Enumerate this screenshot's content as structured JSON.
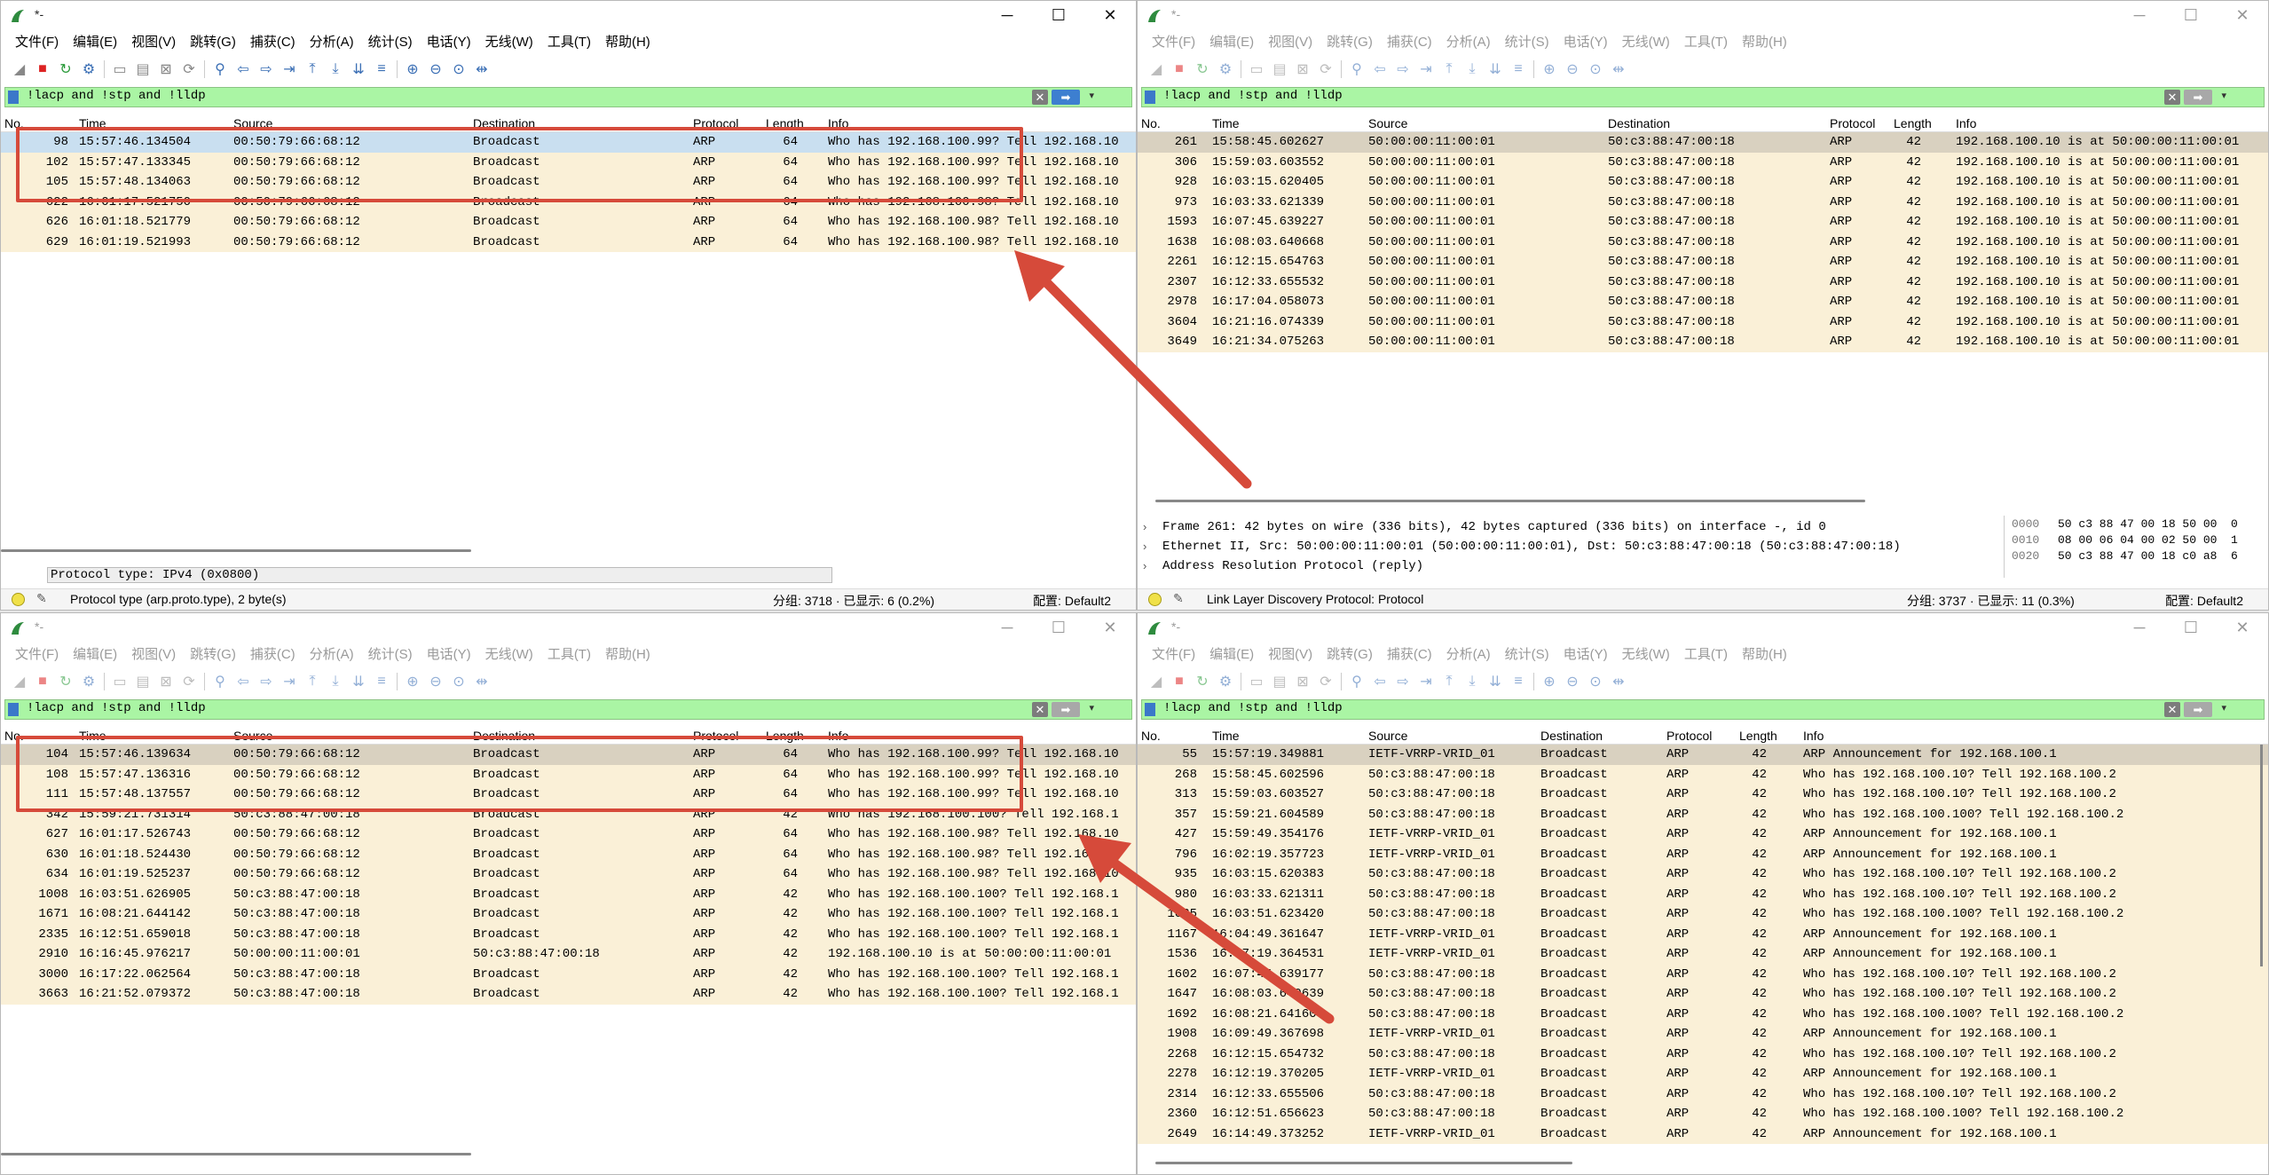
{
  "windows": {
    "tl": {
      "title": "*-",
      "filter": "!lacp and !stp and !lldp",
      "columns": [
        "No.",
        "Time",
        "Source",
        "Destination",
        "Protocol",
        "Length",
        "Info"
      ],
      "rows": [
        [
          "98",
          "15:57:46.134504",
          "00:50:79:66:68:12",
          "Broadcast",
          "ARP",
          "64",
          "Who has 192.168.100.99? Tell 192.168.10"
        ],
        [
          "102",
          "15:57:47.133345",
          "00:50:79:66:68:12",
          "Broadcast",
          "ARP",
          "64",
          "Who has 192.168.100.99? Tell 192.168.10"
        ],
        [
          "105",
          "15:57:48.134063",
          "00:50:79:66:68:12",
          "Broadcast",
          "ARP",
          "64",
          "Who has 192.168.100.99? Tell 192.168.10"
        ],
        [
          "622",
          "16:01:17.521750",
          "00:50:79:66:68:12",
          "Broadcast",
          "ARP",
          "64",
          "Who has 192.168.100.98? Tell 192.168.10"
        ],
        [
          "626",
          "16:01:18.521779",
          "00:50:79:66:68:12",
          "Broadcast",
          "ARP",
          "64",
          "Who has 192.168.100.98? Tell 192.168.10"
        ],
        [
          "629",
          "16:01:19.521993",
          "00:50:79:66:68:12",
          "Broadcast",
          "ARP",
          "64",
          "Who has 192.168.100.98? Tell 192.168.10"
        ]
      ],
      "proto_field": "Protocol type: IPv4 (0x0800)",
      "status_msg": "Protocol type (arp.proto.type), 2 byte(s)",
      "status_packets": "分组: 3718 · 已显示: 6 (0.2%)",
      "status_profile": "配置: Default2"
    },
    "tr": {
      "title": "*-",
      "filter": "!lacp and !stp and !lldp",
      "columns": [
        "No.",
        "Time",
        "Source",
        "Destination",
        "Protocol",
        "Length",
        "Info"
      ],
      "rows": [
        [
          "261",
          "15:58:45.602627",
          "50:00:00:11:00:01",
          "50:c3:88:47:00:18",
          "ARP",
          "42",
          "192.168.100.10 is at 50:00:00:11:00:01"
        ],
        [
          "306",
          "15:59:03.603552",
          "50:00:00:11:00:01",
          "50:c3:88:47:00:18",
          "ARP",
          "42",
          "192.168.100.10 is at 50:00:00:11:00:01"
        ],
        [
          "928",
          "16:03:15.620405",
          "50:00:00:11:00:01",
          "50:c3:88:47:00:18",
          "ARP",
          "42",
          "192.168.100.10 is at 50:00:00:11:00:01"
        ],
        [
          "973",
          "16:03:33.621339",
          "50:00:00:11:00:01",
          "50:c3:88:47:00:18",
          "ARP",
          "42",
          "192.168.100.10 is at 50:00:00:11:00:01"
        ],
        [
          "1593",
          "16:07:45.639227",
          "50:00:00:11:00:01",
          "50:c3:88:47:00:18",
          "ARP",
          "42",
          "192.168.100.10 is at 50:00:00:11:00:01"
        ],
        [
          "1638",
          "16:08:03.640668",
          "50:00:00:11:00:01",
          "50:c3:88:47:00:18",
          "ARP",
          "42",
          "192.168.100.10 is at 50:00:00:11:00:01"
        ],
        [
          "2261",
          "16:12:15.654763",
          "50:00:00:11:00:01",
          "50:c3:88:47:00:18",
          "ARP",
          "42",
          "192.168.100.10 is at 50:00:00:11:00:01"
        ],
        [
          "2307",
          "16:12:33.655532",
          "50:00:00:11:00:01",
          "50:c3:88:47:00:18",
          "ARP",
          "42",
          "192.168.100.10 is at 50:00:00:11:00:01"
        ],
        [
          "2978",
          "16:17:04.058073",
          "50:00:00:11:00:01",
          "50:c3:88:47:00:18",
          "ARP",
          "42",
          "192.168.100.10 is at 50:00:00:11:00:01"
        ],
        [
          "3604",
          "16:21:16.074339",
          "50:00:00:11:00:01",
          "50:c3:88:47:00:18",
          "ARP",
          "42",
          "192.168.100.10 is at 50:00:00:11:00:01"
        ],
        [
          "3649",
          "16:21:34.075263",
          "50:00:00:11:00:01",
          "50:c3:88:47:00:18",
          "ARP",
          "42",
          "192.168.100.10 is at 50:00:00:11:00:01"
        ]
      ],
      "details": [
        "Frame 261: 42 bytes on wire (336 bits), 42 bytes captured (336 bits) on interface -, id 0",
        "Ethernet II, Src: 50:00:00:11:00:01 (50:00:00:11:00:01), Dst: 50:c3:88:47:00:18 (50:c3:88:47:00:18)",
        "Address Resolution Protocol (reply)"
      ],
      "hex": [
        [
          "0000",
          "50 c3 88 47 00 18 50 00  0"
        ],
        [
          "0010",
          "08 00 06 04 00 02 50 00  1"
        ],
        [
          "0020",
          "50 c3 88 47 00 18 c0 a8  6"
        ]
      ],
      "status_msg": "Link Layer Discovery Protocol: Protocol",
      "status_packets": "分组: 3737 · 已显示: 11 (0.3%)",
      "status_profile": "配置: Default2"
    },
    "bl": {
      "title": "*-",
      "filter": "!lacp and !stp and !lldp",
      "columns": [
        "No.",
        "Time",
        "Source",
        "Destination",
        "Protocol",
        "Length",
        "Info"
      ],
      "rows": [
        [
          "104",
          "15:57:46.139634",
          "00:50:79:66:68:12",
          "Broadcast",
          "ARP",
          "64",
          "Who has 192.168.100.99? Tell 192.168.10"
        ],
        [
          "108",
          "15:57:47.136316",
          "00:50:79:66:68:12",
          "Broadcast",
          "ARP",
          "64",
          "Who has 192.168.100.99? Tell 192.168.10"
        ],
        [
          "111",
          "15:57:48.137557",
          "00:50:79:66:68:12",
          "Broadcast",
          "ARP",
          "64",
          "Who has 192.168.100.99? Tell 192.168.10"
        ],
        [
          "342",
          "15:59:21.731314",
          "50:c3:88:47:00:18",
          "Broadcast",
          "ARP",
          "42",
          "Who has 192.168.100.100? Tell 192.168.1"
        ],
        [
          "627",
          "16:01:17.526743",
          "00:50:79:66:68:12",
          "Broadcast",
          "ARP",
          "64",
          "Who has 192.168.100.98? Tell 192.168.10"
        ],
        [
          "630",
          "16:01:18.524430",
          "00:50:79:66:68:12",
          "Broadcast",
          "ARP",
          "64",
          "Who has 192.168.100.98? Tell 192.168.10"
        ],
        [
          "634",
          "16:01:19.525237",
          "00:50:79:66:68:12",
          "Broadcast",
          "ARP",
          "64",
          "Who has 192.168.100.98? Tell 192.168.10"
        ],
        [
          "1008",
          "16:03:51.626905",
          "50:c3:88:47:00:18",
          "Broadcast",
          "ARP",
          "42",
          "Who has 192.168.100.100? Tell 192.168.1"
        ],
        [
          "1671",
          "16:08:21.644142",
          "50:c3:88:47:00:18",
          "Broadcast",
          "ARP",
          "42",
          "Who has 192.168.100.100? Tell 192.168.1"
        ],
        [
          "2335",
          "16:12:51.659018",
          "50:c3:88:47:00:18",
          "Broadcast",
          "ARP",
          "42",
          "Who has 192.168.100.100? Tell 192.168.1"
        ],
        [
          "2910",
          "16:16:45.976217",
          "50:00:00:11:00:01",
          "50:c3:88:47:00:18",
          "ARP",
          "42",
          "192.168.100.10 is at 50:00:00:11:00:01"
        ],
        [
          "3000",
          "16:17:22.062564",
          "50:c3:88:47:00:18",
          "Broadcast",
          "ARP",
          "42",
          "Who has 192.168.100.100? Tell 192.168.1"
        ],
        [
          "3663",
          "16:21:52.079372",
          "50:c3:88:47:00:18",
          "Broadcast",
          "ARP",
          "42",
          "Who has 192.168.100.100? Tell 192.168.1"
        ]
      ]
    },
    "br": {
      "title": "*-",
      "filter": "!lacp and !stp and !lldp",
      "columns": [
        "No.",
        "Time",
        "Source",
        "Destination",
        "Protocol",
        "Length",
        "Info"
      ],
      "rows": [
        [
          "55",
          "15:57:19.349881",
          "IETF-VRRP-VRID_01",
          "Broadcast",
          "ARP",
          "42",
          "ARP Announcement for 192.168.100.1"
        ],
        [
          "268",
          "15:58:45.602596",
          "50:c3:88:47:00:18",
          "Broadcast",
          "ARP",
          "42",
          "Who has 192.168.100.10? Tell 192.168.100.2"
        ],
        [
          "313",
          "15:59:03.603527",
          "50:c3:88:47:00:18",
          "Broadcast",
          "ARP",
          "42",
          "Who has 192.168.100.10? Tell 192.168.100.2"
        ],
        [
          "357",
          "15:59:21.604589",
          "50:c3:88:47:00:18",
          "Broadcast",
          "ARP",
          "42",
          "Who has 192.168.100.100? Tell 192.168.100.2"
        ],
        [
          "427",
          "15:59:49.354176",
          "IETF-VRRP-VRID_01",
          "Broadcast",
          "ARP",
          "42",
          "ARP Announcement for 192.168.100.1"
        ],
        [
          "796",
          "16:02:19.357723",
          "IETF-VRRP-VRID_01",
          "Broadcast",
          "ARP",
          "42",
          "ARP Announcement for 192.168.100.1"
        ],
        [
          "935",
          "16:03:15.620383",
          "50:c3:88:47:00:18",
          "Broadcast",
          "ARP",
          "42",
          "Who has 192.168.100.10? Tell 192.168.100.2"
        ],
        [
          "980",
          "16:03:33.621311",
          "50:c3:88:47:00:18",
          "Broadcast",
          "ARP",
          "42",
          "Who has 192.168.100.10? Tell 192.168.100.2"
        ],
        [
          "1025",
          "16:03:51.623420",
          "50:c3:88:47:00:18",
          "Broadcast",
          "ARP",
          "42",
          "Who has 192.168.100.100? Tell 192.168.100.2"
        ],
        [
          "1167",
          "16:04:49.361647",
          "IETF-VRRP-VRID_01",
          "Broadcast",
          "ARP",
          "42",
          "ARP Announcement for 192.168.100.1"
        ],
        [
          "1536",
          "16:07:19.364531",
          "IETF-VRRP-VRID_01",
          "Broadcast",
          "ARP",
          "42",
          "ARP Announcement for 192.168.100.1"
        ],
        [
          "1602",
          "16:07:45.639177",
          "50:c3:88:47:00:18",
          "Broadcast",
          "ARP",
          "42",
          "Who has 192.168.100.10? Tell 192.168.100.2"
        ],
        [
          "1647",
          "16:08:03.640639",
          "50:c3:88:47:00:18",
          "Broadcast",
          "ARP",
          "42",
          "Who has 192.168.100.10? Tell 192.168.100.2"
        ],
        [
          "1692",
          "16:08:21.641604",
          "50:c3:88:47:00:18",
          "Broadcast",
          "ARP",
          "42",
          "Who has 192.168.100.100? Tell 192.168.100.2"
        ],
        [
          "1908",
          "16:09:49.367698",
          "IETF-VRRP-VRID_01",
          "Broadcast",
          "ARP",
          "42",
          "ARP Announcement for 192.168.100.1"
        ],
        [
          "2268",
          "16:12:15.654732",
          "50:c3:88:47:00:18",
          "Broadcast",
          "ARP",
          "42",
          "Who has 192.168.100.10? Tell 192.168.100.2"
        ],
        [
          "2278",
          "16:12:19.370205",
          "IETF-VRRP-VRID_01",
          "Broadcast",
          "ARP",
          "42",
          "ARP Announcement for 192.168.100.1"
        ],
        [
          "2314",
          "16:12:33.655506",
          "50:c3:88:47:00:18",
          "Broadcast",
          "ARP",
          "42",
          "Who has 192.168.100.10? Tell 192.168.100.2"
        ],
        [
          "2360",
          "16:12:51.656623",
          "50:c3:88:47:00:18",
          "Broadcast",
          "ARP",
          "42",
          "Who has 192.168.100.100? Tell 192.168.100.2"
        ],
        [
          "2649",
          "16:14:49.373252",
          "IETF-VRRP-VRID_01",
          "Broadcast",
          "ARP",
          "42",
          "ARP Announcement for 192.168.100.1"
        ]
      ]
    }
  },
  "menu": [
    "文件(F)",
    "编辑(E)",
    "视图(V)",
    "跳转(G)",
    "捕获(C)",
    "分析(A)",
    "统计(S)",
    "电话(Y)",
    "无线(W)",
    "工具(T)",
    "帮助(H)"
  ],
  "controls": {
    "min": "─",
    "max": "☐",
    "close": "✕",
    "clear": "✕",
    "apply": "➡",
    "dropdown": "▾",
    "plus": "+",
    "chevron": "›",
    "pen": "✎"
  },
  "colors": {
    "filter_ok": "#aaf5a4",
    "row_bg": "#faf0d7",
    "row_selected": "#c9dff0",
    "annotation": "#d64a3a"
  },
  "toolbar_icons": [
    "shark-fin-icon",
    "stop-capture-icon",
    "restart-capture-icon",
    "capture-options-icon",
    "open-file-icon",
    "save-file-icon",
    "close-file-icon",
    "reload-icon",
    "find-packet-icon",
    "go-back-icon",
    "go-forward-icon",
    "go-to-packet-icon",
    "first-packet-icon",
    "last-packet-icon",
    "autoscroll-icon",
    "colorize-icon",
    "zoom-in-icon",
    "zoom-out-icon",
    "normal-size-icon",
    "resize-columns-icon"
  ]
}
